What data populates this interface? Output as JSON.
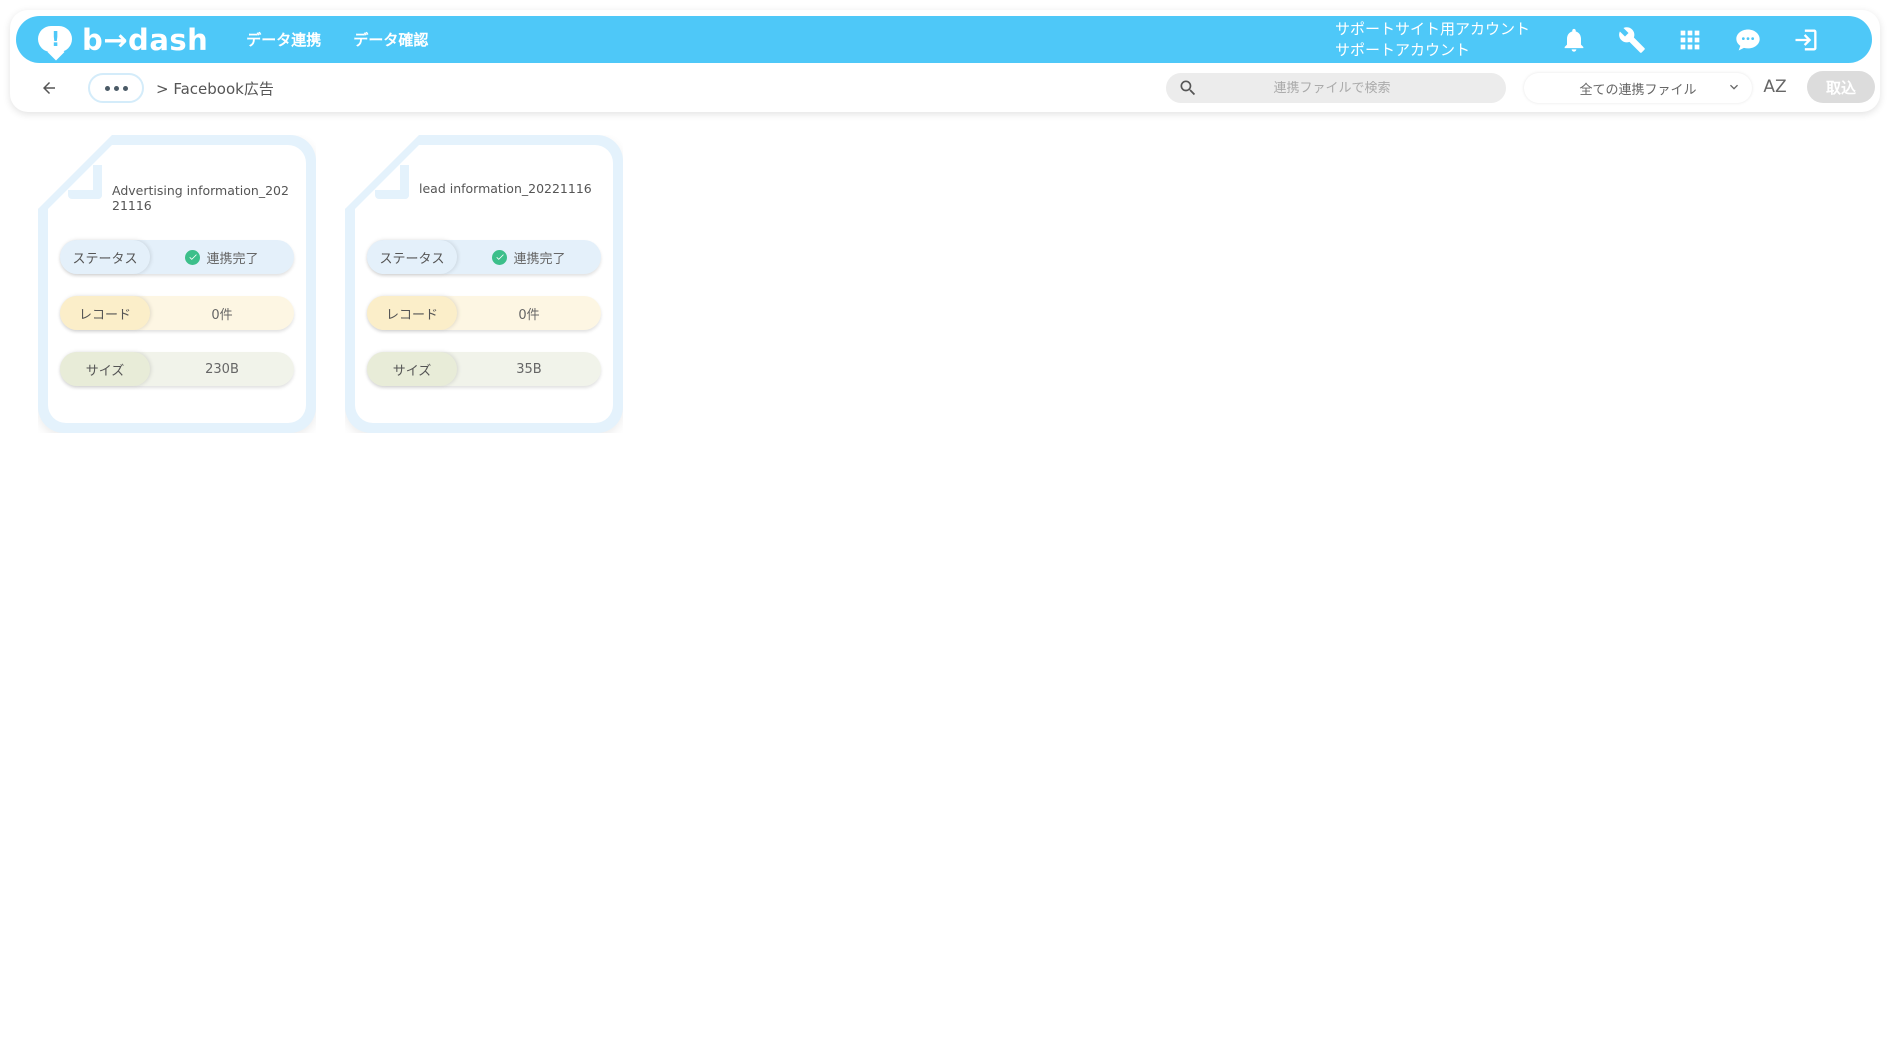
{
  "header": {
    "logo_text": "b→dash",
    "nav": [
      "データ連携",
      "データ確認"
    ],
    "account_line1": "サポートサイト用アカウント",
    "account_line2": "サポートアカウント",
    "icons": [
      "bell-icon",
      "wrench-icon",
      "apps-grid-icon",
      "support-chat-icon",
      "logout-icon"
    ]
  },
  "toolbar": {
    "breadcrumb": "> Facebook広告",
    "search_placeholder": "連携ファイルで検索",
    "filter_value": "全ての連携ファイル",
    "sort_label": "AZ",
    "import_label": "取込"
  },
  "cards": [
    {
      "title": "Advertising information_20221116",
      "status_label": "ステータス",
      "status_value": "連携完了",
      "record_label": "レコード",
      "record_value": "0件",
      "size_label": "サイズ",
      "size_value": "230B"
    },
    {
      "title": "lead information_20221116",
      "status_label": "ステータス",
      "status_value": "連携完了",
      "record_label": "レコード",
      "record_value": "0件",
      "size_label": "サイズ",
      "size_value": "35B"
    }
  ],
  "colors": {
    "brand": "#4ec8f8",
    "success": "#3cbf8a"
  }
}
